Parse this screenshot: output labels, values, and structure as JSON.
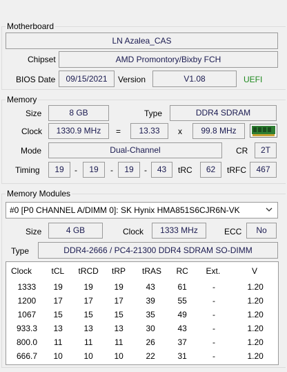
{
  "motherboard": {
    "title": "Motherboard",
    "name": "LN Azalea_CAS",
    "chipset_label": "Chipset",
    "chipset": "AMD Promontory/Bixby FCH",
    "bios_date_label": "BIOS Date",
    "bios_date": "09/15/2021",
    "version_label": "Version",
    "version": "V1.08",
    "uefi": "UEFI"
  },
  "memory": {
    "title": "Memory",
    "size_label": "Size",
    "size": "8 GB",
    "type_label": "Type",
    "type": "DDR4 SDRAM",
    "clock_label": "Clock",
    "clock": "1330.9 MHz",
    "equals": "=",
    "multiplier": "13.33",
    "times": "x",
    "bus": "99.8 MHz",
    "mode_label": "Mode",
    "mode": "Dual-Channel",
    "cr_label": "CR",
    "cr": "2T",
    "timing_label": "Timing",
    "timings": [
      "19",
      "19",
      "19",
      "43"
    ],
    "dash": "-",
    "trc_label": "tRC",
    "trc": "62",
    "trfc_label": "tRFC",
    "trfc": "467"
  },
  "modules": {
    "title": "Memory Modules",
    "selected": "#0 [P0 CHANNEL A/DIMM 0]: SK Hynix HMA851S6CJR6N-VK",
    "size_label": "Size",
    "size": "4 GB",
    "clock_label": "Clock",
    "clock": "1333 MHz",
    "ecc_label": "ECC",
    "ecc": "No",
    "type_label": "Type",
    "type": "DDR4-2666 / PC4-21300 DDR4 SDRAM SO-DIMM",
    "table": {
      "headers": [
        "Clock",
        "tCL",
        "tRCD",
        "tRP",
        "tRAS",
        "RC",
        "Ext.",
        "V"
      ],
      "rows": [
        [
          "1333",
          "19",
          "19",
          "19",
          "43",
          "61",
          "-",
          "1.20"
        ],
        [
          "1200",
          "17",
          "17",
          "17",
          "39",
          "55",
          "-",
          "1.20"
        ],
        [
          "1067",
          "15",
          "15",
          "15",
          "35",
          "49",
          "-",
          "1.20"
        ],
        [
          "933.3",
          "13",
          "13",
          "13",
          "30",
          "43",
          "-",
          "1.20"
        ],
        [
          "800.0",
          "11",
          "11",
          "11",
          "26",
          "37",
          "-",
          "1.20"
        ],
        [
          "666.7",
          "10",
          "10",
          "10",
          "22",
          "31",
          "-",
          "1.20"
        ]
      ]
    }
  },
  "colors": {
    "value_text": "#1a1a50",
    "uefi": "#1e8a1e",
    "ram_chip": "#2e7d32"
  }
}
